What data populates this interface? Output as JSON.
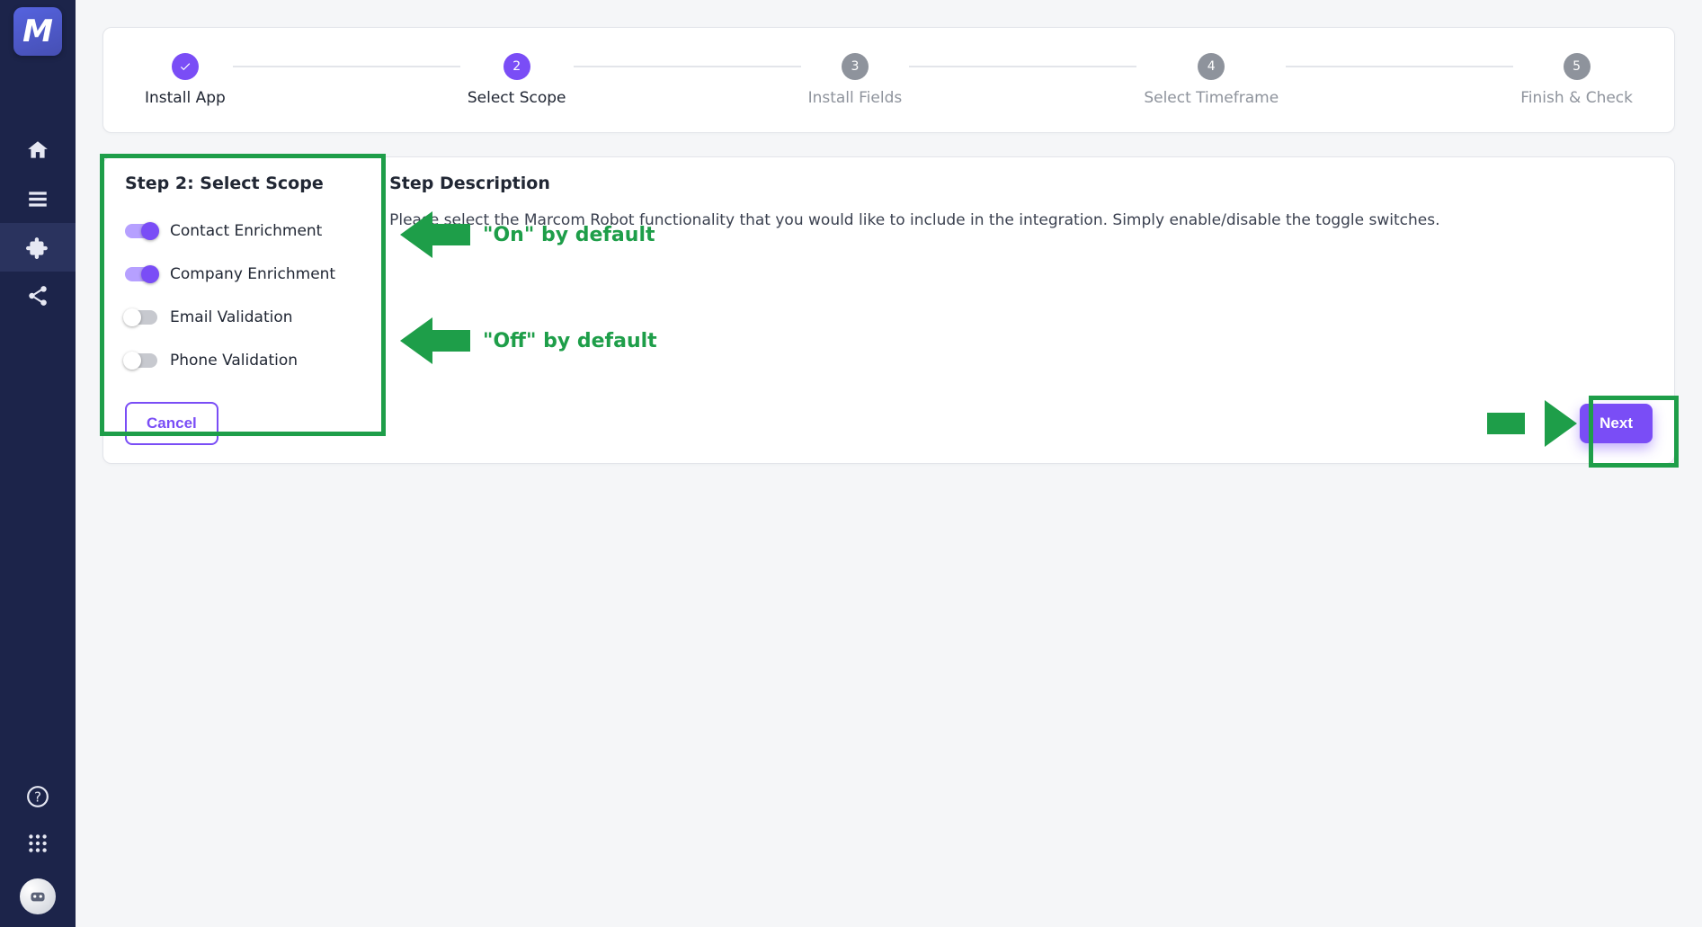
{
  "sidebar": {
    "logo_text": "M",
    "items": [
      {
        "name": "home-icon"
      },
      {
        "name": "menu-icon"
      },
      {
        "name": "puzzle-icon",
        "active": true
      },
      {
        "name": "share-icon"
      }
    ],
    "bottom_items": [
      {
        "name": "help-icon"
      },
      {
        "name": "grid-dots-icon"
      },
      {
        "name": "bot-avatar"
      }
    ]
  },
  "stepper": {
    "steps": [
      {
        "label": "Install App",
        "state": "done"
      },
      {
        "label": "Select Scope",
        "state": "current",
        "num": "2"
      },
      {
        "label": "Install Fields",
        "state": "pending",
        "num": "3"
      },
      {
        "label": "Select Timeframe",
        "state": "pending",
        "num": "4"
      },
      {
        "label": "Finish & Check",
        "state": "pending",
        "num": "5"
      }
    ]
  },
  "form": {
    "title": "Step 2: Select Scope",
    "toggles": [
      {
        "label": "Contact Enrichment",
        "on": true
      },
      {
        "label": "Company Enrichment",
        "on": true
      },
      {
        "label": "Email Validation",
        "on": false
      },
      {
        "label": "Phone Validation",
        "on": false
      }
    ],
    "desc_title": "Step Description",
    "desc_text": "Please select the Marcom Robot functionality that you would like to include in the integration. Simply enable/disable the toggle switches.",
    "cancel_label": "Cancel",
    "next_label": "Next"
  },
  "annotations": {
    "on_label": "\"On\" by default",
    "off_label": "\"Off\" by default"
  }
}
